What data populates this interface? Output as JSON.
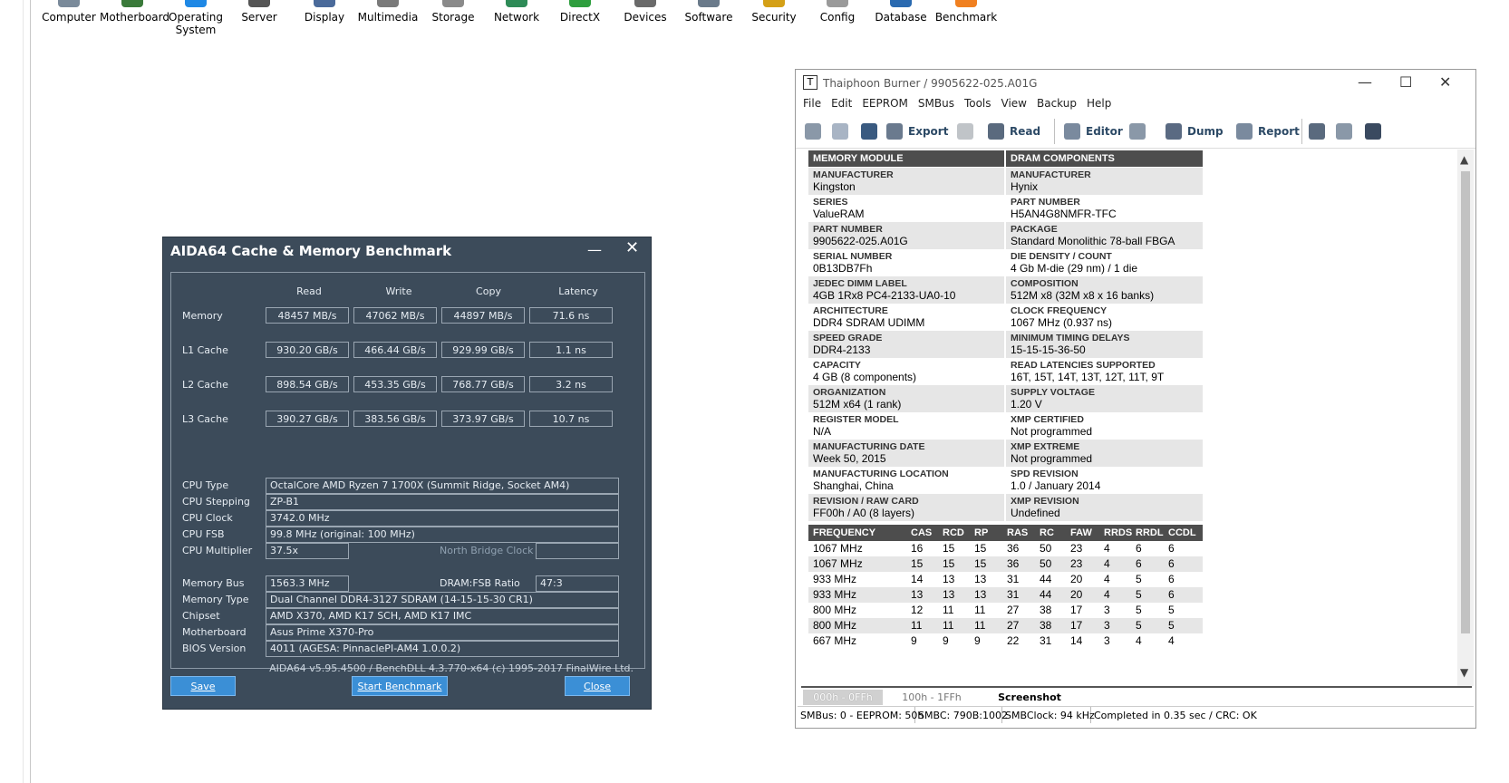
{
  "aida_toolbar": [
    {
      "label": "Computer",
      "color": "#7a8a9a"
    },
    {
      "label": "Motherboard",
      "color": "#3a7a3a"
    },
    {
      "label": "Operating System",
      "color": "#1e88e5"
    },
    {
      "label": "Server",
      "color": "#555555"
    },
    {
      "label": "Display",
      "color": "#4a6a9a"
    },
    {
      "label": "Multimedia",
      "color": "#7a7a7a"
    },
    {
      "label": "Storage",
      "color": "#8a8a8a"
    },
    {
      "label": "Network",
      "color": "#2e8b57"
    },
    {
      "label": "DirectX",
      "color": "#2e9e3e"
    },
    {
      "label": "Devices",
      "color": "#6a6a6a"
    },
    {
      "label": "Software",
      "color": "#6a7a8a"
    },
    {
      "label": "Security",
      "color": "#d4a017"
    },
    {
      "label": "Config",
      "color": "#9a9a9a"
    },
    {
      "label": "Database",
      "color": "#2a6ab0"
    },
    {
      "label": "Benchmark",
      "color": "#f08020"
    }
  ],
  "bench": {
    "title": "AIDA64 Cache & Memory Benchmark",
    "minimize": "—",
    "close": "✕",
    "columns": [
      "Read",
      "Write",
      "Copy",
      "Latency"
    ],
    "rows": [
      {
        "label": "Memory",
        "values": [
          "48457 MB/s",
          "47062 MB/s",
          "44897 MB/s",
          "71.6 ns"
        ]
      },
      {
        "label": "L1 Cache",
        "values": [
          "930.20 GB/s",
          "466.44 GB/s",
          "929.99 GB/s",
          "1.1 ns"
        ]
      },
      {
        "label": "L2 Cache",
        "values": [
          "898.54 GB/s",
          "453.35 GB/s",
          "768.77 GB/s",
          "3.2 ns"
        ]
      },
      {
        "label": "L3 Cache",
        "values": [
          "390.27 GB/s",
          "383.56 GB/s",
          "373.97 GB/s",
          "10.7 ns"
        ]
      }
    ],
    "cpu_type_label": "CPU Type",
    "cpu_type": "OctalCore AMD Ryzen 7 1700X (Summit Ridge, Socket AM4)",
    "cpu_stepping_label": "CPU Stepping",
    "cpu_stepping": "ZP-B1",
    "cpu_clock_label": "CPU Clock",
    "cpu_clock": "3742.0 MHz",
    "cpu_fsb_label": "CPU FSB",
    "cpu_fsb": "99.8 MHz  (original: 100 MHz)",
    "cpu_multiplier_label": "CPU Multiplier",
    "cpu_multiplier": "37.5x",
    "nb_clock_label": "North Bridge Clock",
    "nb_clock": "",
    "memory_bus_label": "Memory Bus",
    "memory_bus": "1563.3 MHz",
    "dram_fsb_label": "DRAM:FSB Ratio",
    "dram_fsb": "47:3",
    "memory_type_label": "Memory Type",
    "memory_type": "Dual Channel DDR4-3127 SDRAM  (14-15-15-30 CR1)",
    "chipset_label": "Chipset",
    "chipset": "AMD X370, AMD K17 SCH, AMD K17 IMC",
    "motherboard_label": "Motherboard",
    "motherboard": "Asus Prime X370-Pro",
    "bios_label": "BIOS Version",
    "bios": "4011  (AGESA: PinnaclePI-AM4 1.0.0.2)",
    "footer": "AIDA64 v5.95.4500 / BenchDLL 4.3.770-x64  (c) 1995-2017 FinalWire Ltd.",
    "save_label": "Save",
    "start_label": "Start Benchmark",
    "close_label": "Close"
  },
  "thai": {
    "title": "Thaiphoon Burner / 9905622-025.A01G",
    "min": "—",
    "max": "☐",
    "close": "✕",
    "menu": [
      "File",
      "Edit",
      "EEPROM",
      "SMBus",
      "Tools",
      "View",
      "Backup",
      "Help"
    ],
    "tools": {
      "export": "Export",
      "read": "Read",
      "editor": "Editor",
      "dump": "Dump",
      "report": "Report"
    },
    "mm_head": "MEMORY MODULE",
    "dc_head": "DRAM COMPONENTS",
    "module": [
      {
        "k": "MANUFACTURER",
        "v": "Kingston"
      },
      {
        "k": "SERIES",
        "v": "ValueRAM"
      },
      {
        "k": "PART NUMBER",
        "v": "9905622-025.A01G"
      },
      {
        "k": "SERIAL NUMBER",
        "v": "0B13DB7Fh"
      },
      {
        "k": "JEDEC DIMM LABEL",
        "v": "4GB 1Rx8 PC4-2133-UA0-10"
      },
      {
        "k": "ARCHITECTURE",
        "v": "DDR4 SDRAM UDIMM"
      },
      {
        "k": "SPEED GRADE",
        "v": "DDR4-2133"
      },
      {
        "k": "CAPACITY",
        "v": "4 GB (8 components)"
      },
      {
        "k": "ORGANIZATION",
        "v": "512M x64 (1 rank)"
      },
      {
        "k": "REGISTER MODEL",
        "v": "N/A"
      },
      {
        "k": "MANUFACTURING DATE",
        "v": "Week 50, 2015"
      },
      {
        "k": "MANUFACTURING LOCATION",
        "v": "Shanghai, China"
      },
      {
        "k": "REVISION / RAW CARD",
        "v": "FF00h / A0 (8 layers)"
      }
    ],
    "components": [
      {
        "k": "MANUFACTURER",
        "v": "Hynix"
      },
      {
        "k": "PART NUMBER",
        "v": "H5AN4G8NMFR-TFC"
      },
      {
        "k": "PACKAGE",
        "v": "Standard Monolithic 78-ball FBGA"
      },
      {
        "k": "DIE DENSITY / COUNT",
        "v": "4 Gb M-die (29 nm) / 1 die"
      },
      {
        "k": "COMPOSITION",
        "v": "512M x8 (32M x8 x 16 banks)"
      },
      {
        "k": "CLOCK FREQUENCY",
        "v": "1067 MHz (0.937 ns)"
      },
      {
        "k": "MINIMUM TIMING DELAYS",
        "v": "15-15-15-36-50"
      },
      {
        "k": "READ LATENCIES SUPPORTED",
        "v": "16T, 15T, 14T, 13T, 12T, 11T, 9T"
      },
      {
        "k": "SUPPLY VOLTAGE",
        "v": "1.20 V"
      },
      {
        "k": "XMP CERTIFIED",
        "v": "Not programmed"
      },
      {
        "k": "XMP EXTREME",
        "v": "Not programmed"
      },
      {
        "k": "SPD REVISION",
        "v": "1.0 / January 2014"
      },
      {
        "k": "XMP REVISION",
        "v": "Undefined"
      }
    ],
    "timing_headers": [
      "FREQUENCY",
      "CAS",
      "RCD",
      "RP",
      "RAS",
      "RC",
      "FAW",
      "RRDS",
      "RRDL",
      "CCDL"
    ],
    "timings": [
      [
        "1067 MHz",
        "16",
        "15",
        "15",
        "36",
        "50",
        "23",
        "4",
        "6",
        "6"
      ],
      [
        "1067 MHz",
        "15",
        "15",
        "15",
        "36",
        "50",
        "23",
        "4",
        "6",
        "6"
      ],
      [
        "933 MHz",
        "14",
        "13",
        "13",
        "31",
        "44",
        "20",
        "4",
        "5",
        "6"
      ],
      [
        "933 MHz",
        "13",
        "13",
        "13",
        "31",
        "44",
        "20",
        "4",
        "5",
        "6"
      ],
      [
        "800 MHz",
        "12",
        "11",
        "11",
        "27",
        "38",
        "17",
        "3",
        "5",
        "5"
      ],
      [
        "800 MHz",
        "11",
        "11",
        "11",
        "27",
        "38",
        "17",
        "3",
        "5",
        "5"
      ],
      [
        "667 MHz",
        "9",
        "9",
        "9",
        "22",
        "31",
        "14",
        "3",
        "4",
        "4"
      ]
    ],
    "tabs": [
      "000h - 0FFh",
      "100h - 1FFh",
      "Screenshot"
    ],
    "status": [
      "SMBus: 0 - EEPROM: 50h",
      "SMBC: 790B:1002",
      "SMBClock: 94 kHz",
      "Completed in 0.35 sec / CRC: OK"
    ]
  }
}
